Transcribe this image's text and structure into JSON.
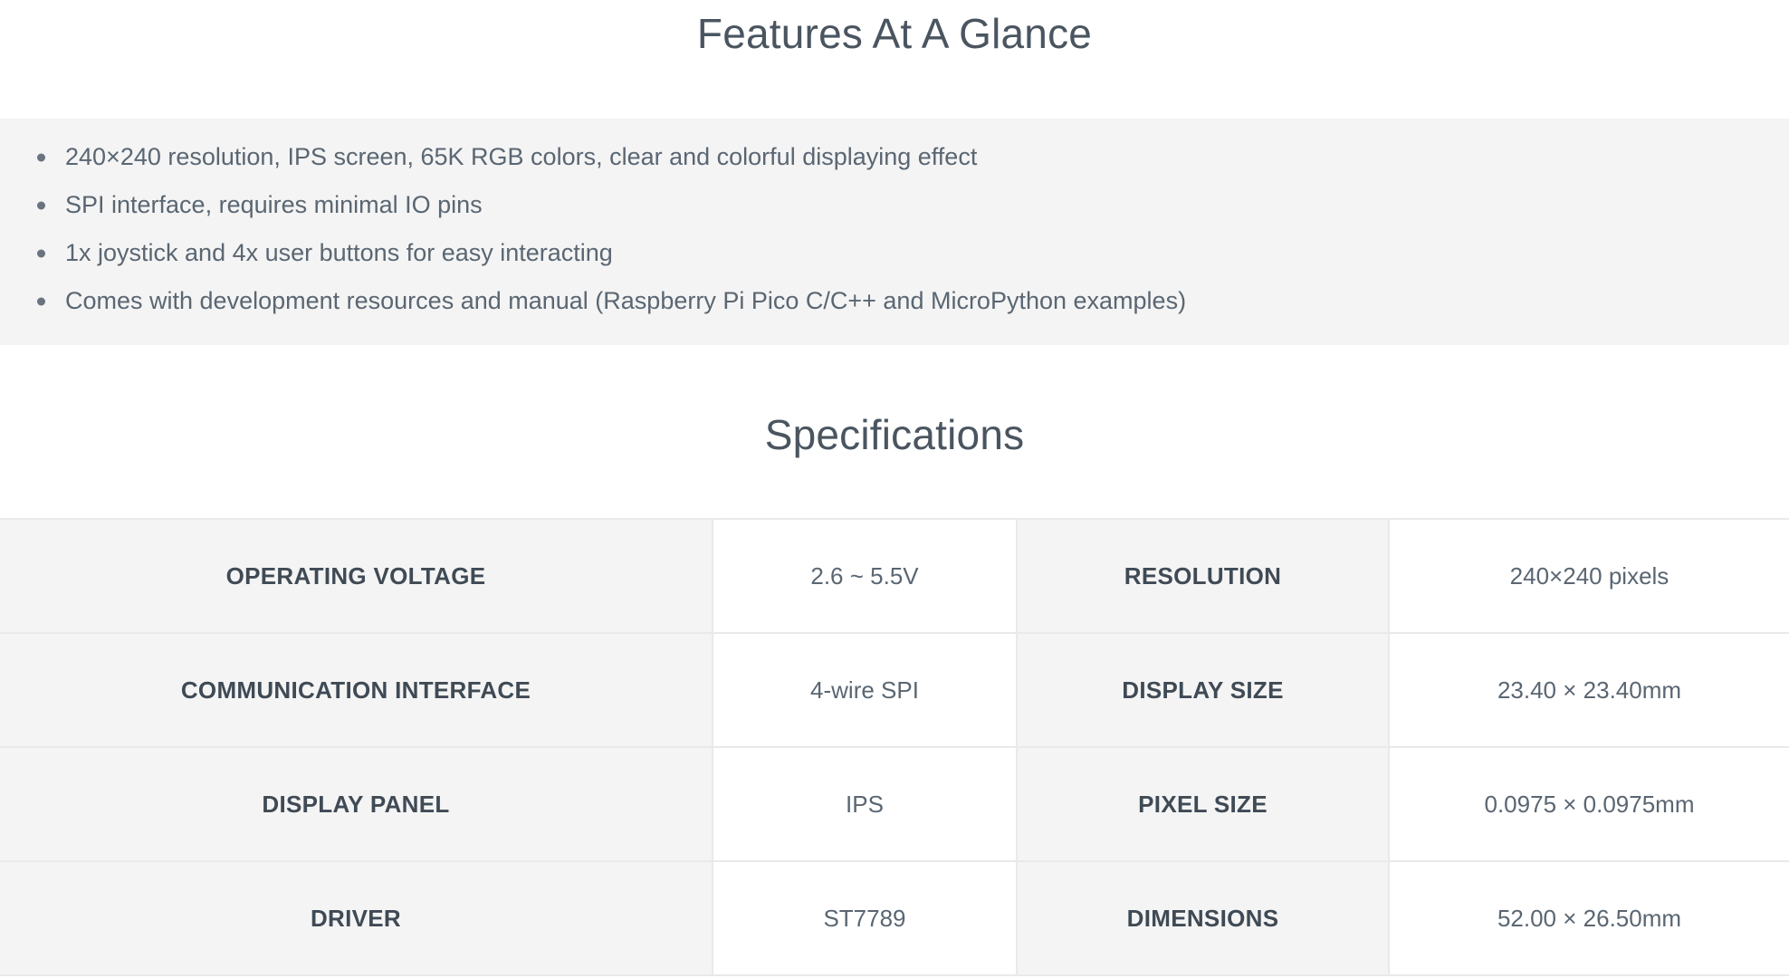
{
  "features": {
    "heading": "Features At A Glance",
    "items": [
      "240×240 resolution, IPS screen, 65K RGB colors, clear and colorful displaying effect",
      "SPI interface, requires minimal IO pins",
      "1x joystick and 4x user buttons for easy interacting",
      "Comes with development resources and manual (Raspberry Pi Pico C/C++ and MicroPython examples)"
    ]
  },
  "specifications": {
    "heading": "Specifications",
    "rows": [
      {
        "label_left": "OPERATING VOLTAGE",
        "value_left": "2.6 ~ 5.5V",
        "label_right": "RESOLUTION",
        "value_right": "240×240 pixels"
      },
      {
        "label_left": "COMMUNICATION INTERFACE",
        "value_left": "4-wire SPI",
        "label_right": "DISPLAY SIZE",
        "value_right": "23.40 × 23.40mm"
      },
      {
        "label_left": "DISPLAY PANEL",
        "value_left": "IPS",
        "label_right": "PIXEL SIZE",
        "value_right": "0.0975 × 0.0975mm"
      },
      {
        "label_left": "DRIVER",
        "value_left": "ST7789",
        "label_right": "DIMENSIONS",
        "value_right": "52.00 × 26.50mm"
      }
    ]
  },
  "colors": {
    "panel_background": "#f4f4f4",
    "text": "#5a6672",
    "heading": "#4a5560",
    "border": "#e9e9e9"
  }
}
